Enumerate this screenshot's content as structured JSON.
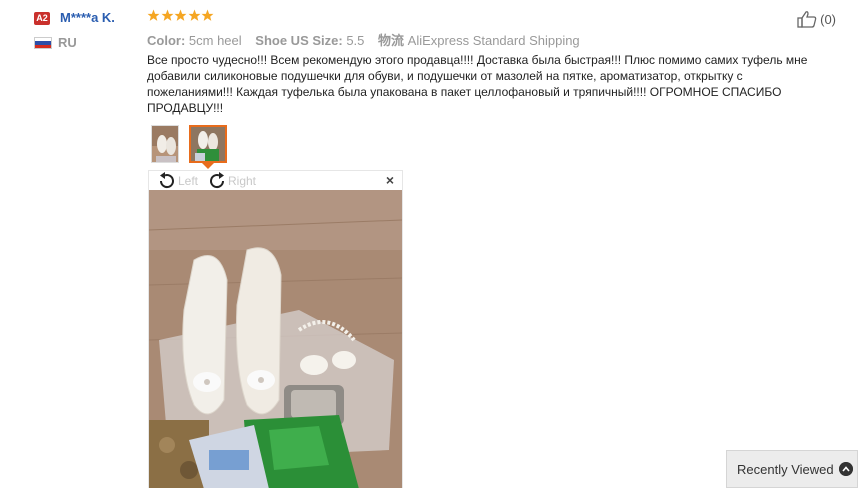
{
  "reviewer": {
    "level_badge": "A2",
    "name": "M****a K.",
    "country": "RU"
  },
  "rating": {
    "stars": 5,
    "max": 5,
    "color": "#f5a623"
  },
  "helpful": {
    "count_label": "(0)"
  },
  "attributes": [
    {
      "key": "Color:",
      "value": "5cm heel"
    },
    {
      "key": "Shoe US Size:",
      "value": "5.5"
    },
    {
      "key": "物流",
      "value": "AliExpress Standard Shipping"
    }
  ],
  "review_text": "Все просто чудесно!!! Всем рекомендую этого продавца!!!! Доставка была быстрая!!! Плюс помимо самих туфель мне добавили силиконовые подушечки для обуви, и подушечки от мазолей на пятке, ароматизатор, открытку с пожеланиями!!! Каждая туфелька была упакована в пакет целлофановый и тряпичный!!!! ОГРОМНОЕ СПАСИБО ПРОДАВЦУ!!!",
  "viewer": {
    "rotate_left_label": "Left",
    "rotate_right_label": "Right",
    "close_label": "×"
  },
  "recently_viewed": {
    "label": "Recently Viewed"
  },
  "icons": {
    "like": "thumbs-up-icon",
    "rotate_left": "rotate-left-icon",
    "rotate_right": "rotate-right-icon",
    "close": "close-icon",
    "expand": "chevron-up-icon"
  },
  "colors": {
    "accent": "#e86c1c",
    "name_link": "#2a5db0",
    "badge": "#c9302c"
  }
}
